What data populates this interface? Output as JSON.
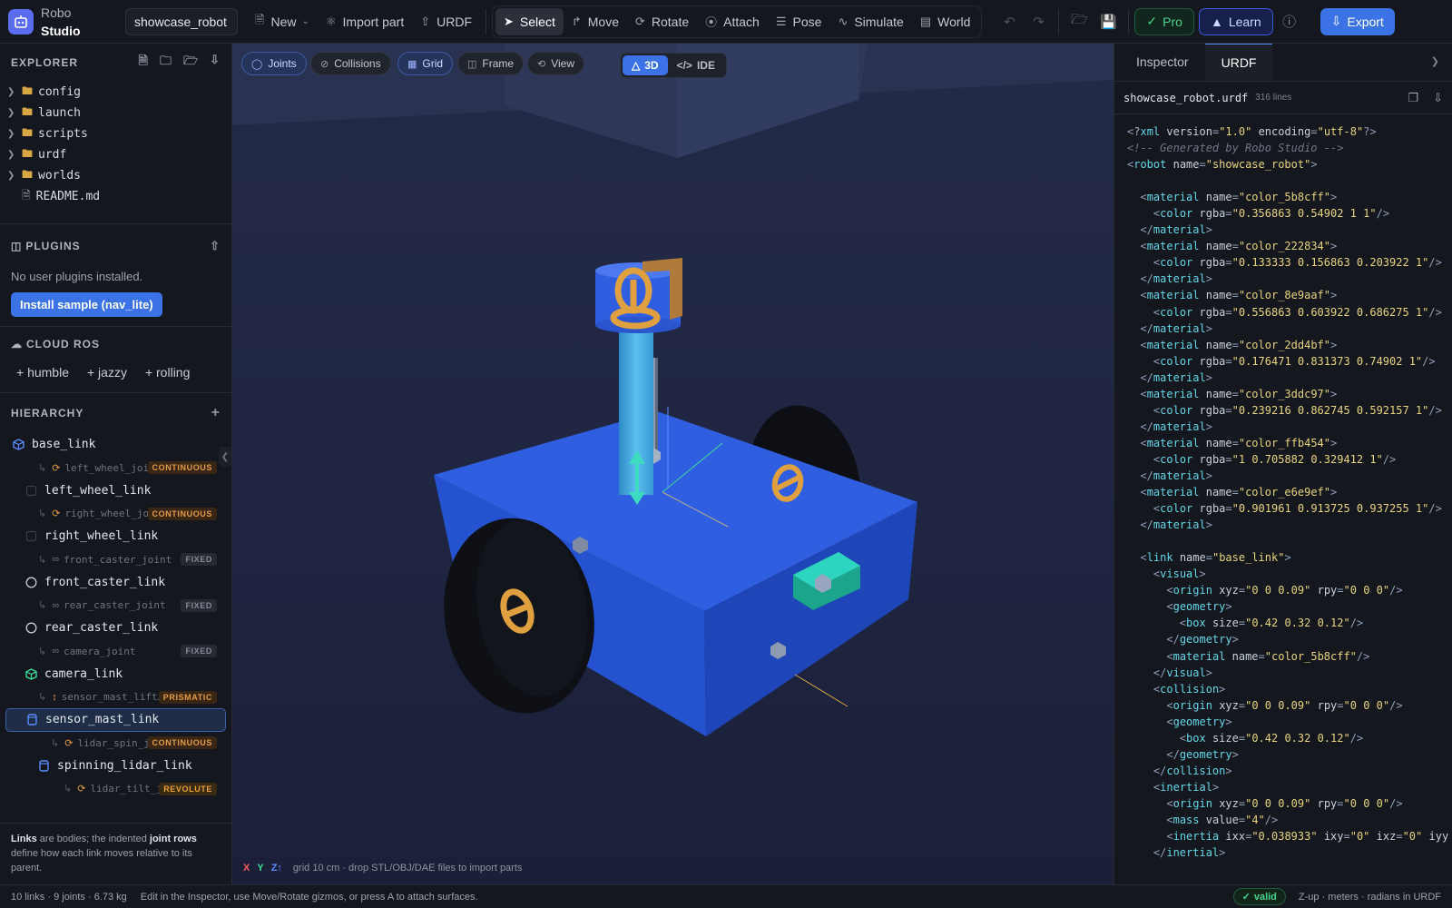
{
  "app": {
    "name_line1": "Robo",
    "name_line2": "Studio",
    "project_name": "showcase_robot"
  },
  "toolbar": {
    "new": "New",
    "import_part": "Import part",
    "urdf": "URDF",
    "modes": [
      "Select",
      "Move",
      "Rotate",
      "Attach",
      "Pose",
      "Simulate",
      "World"
    ],
    "active_mode": "Select",
    "pro": "Pro",
    "learn": "Learn",
    "export": "Export"
  },
  "explorer": {
    "title": "EXPLORER",
    "folders": [
      "config",
      "launch",
      "scripts",
      "urdf",
      "worlds"
    ],
    "files": [
      "README.md"
    ]
  },
  "plugins": {
    "title": "PLUGINS",
    "empty": "No user plugins installed.",
    "install": "Install sample (nav_lite)"
  },
  "cloud_ros": {
    "title": "CLOUD ROS",
    "distros": [
      "+ humble",
      "+ jazzy",
      "+ rolling"
    ]
  },
  "hierarchy": {
    "title": "HIERARCHY",
    "rows": [
      {
        "kind": "link",
        "name": "base_link",
        "indent": 0,
        "icon": "cube"
      },
      {
        "kind": "joint",
        "name": "left_wheel_joi…",
        "type": "CONTINUOUS",
        "indent": 1
      },
      {
        "kind": "link",
        "name": "left_wheel_link",
        "indent": 1,
        "icon": "cylinder"
      },
      {
        "kind": "joint",
        "name": "right_wheel_jo…",
        "type": "CONTINUOUS",
        "indent": 1
      },
      {
        "kind": "link",
        "name": "right_wheel_link",
        "indent": 1,
        "icon": "cylinder"
      },
      {
        "kind": "joint",
        "name": "front_caster_joint",
        "type": "FIXED",
        "indent": 1
      },
      {
        "kind": "link",
        "name": "front_caster_link",
        "indent": 1,
        "icon": "sphere"
      },
      {
        "kind": "joint",
        "name": "rear_caster_joint",
        "type": "FIXED",
        "indent": 1
      },
      {
        "kind": "link",
        "name": "rear_caster_link",
        "indent": 1,
        "icon": "sphere"
      },
      {
        "kind": "joint",
        "name": "camera_joint",
        "type": "FIXED",
        "indent": 1
      },
      {
        "kind": "link",
        "name": "camera_link",
        "indent": 1,
        "icon": "mesh"
      },
      {
        "kind": "joint",
        "name": "sensor_mast_lift…",
        "type": "PRISMATIC",
        "indent": 1
      },
      {
        "kind": "link",
        "name": "sensor_mast_link",
        "indent": 1,
        "icon": "mast",
        "selected": true
      },
      {
        "kind": "joint",
        "name": "lidar_spin_j…",
        "type": "CONTINUOUS",
        "indent": 2
      },
      {
        "kind": "link",
        "name": "spinning_lidar_link",
        "indent": 2,
        "icon": "mast"
      },
      {
        "kind": "joint",
        "name": "lidar_tilt_j…",
        "type": "REVOLUTE",
        "indent": 3
      }
    ],
    "footnote_parts": [
      "Links",
      " are bodies; the indented ",
      "joint rows",
      " define how each link moves relative to its parent."
    ]
  },
  "viewport": {
    "toggles": [
      "Joints",
      "Collisions",
      "Grid",
      "Frame",
      "View"
    ],
    "active_toggles": [
      "Joints",
      "Grid"
    ],
    "view_modes": [
      "3D",
      "IDE"
    ],
    "active_view": "3D",
    "axes": [
      "X",
      "Y",
      "Z↑"
    ],
    "hint": "grid 10 cm · drop STL/OBJ/DAE files to import parts"
  },
  "inspector": {
    "tabs": [
      "Inspector",
      "URDF"
    ],
    "active_tab": "URDF",
    "file_name": "showcase_robot.urdf",
    "line_count": "316 lines",
    "code_lines": [
      "<?xml version=\"1.0\" encoding=\"utf-8\"?>",
      "<!-- Generated by Robo Studio -->",
      "<robot name=\"showcase_robot\">",
      "",
      "  <material name=\"color_5b8cff\">",
      "    <color rgba=\"0.356863 0.54902 1 1\"/>",
      "  </material>",
      "  <material name=\"color_222834\">",
      "    <color rgba=\"0.133333 0.156863 0.203922 1\"/>",
      "  </material>",
      "  <material name=\"color_8e9aaf\">",
      "    <color rgba=\"0.556863 0.603922 0.686275 1\"/>",
      "  </material>",
      "  <material name=\"color_2dd4bf\">",
      "    <color rgba=\"0.176471 0.831373 0.74902 1\"/>",
      "  </material>",
      "  <material name=\"color_3ddc97\">",
      "    <color rgba=\"0.239216 0.862745 0.592157 1\"/>",
      "  </material>",
      "  <material name=\"color_ffb454\">",
      "    <color rgba=\"1 0.705882 0.329412 1\"/>",
      "  </material>",
      "  <material name=\"color_e6e9ef\">",
      "    <color rgba=\"0.901961 0.913725 0.937255 1\"/>",
      "  </material>",
      "",
      "  <link name=\"base_link\">",
      "    <visual>",
      "      <origin xyz=\"0 0 0.09\" rpy=\"0 0 0\"/>",
      "      <geometry>",
      "        <box size=\"0.42 0.32 0.12\"/>",
      "      </geometry>",
      "      <material name=\"color_5b8cff\"/>",
      "    </visual>",
      "    <collision>",
      "      <origin xyz=\"0 0 0.09\" rpy=\"0 0 0\"/>",
      "      <geometry>",
      "        <box size=\"0.42 0.32 0.12\"/>",
      "      </geometry>",
      "    </collision>",
      "    <inertial>",
      "      <origin xyz=\"0 0 0.09\" rpy=\"0 0 0\"/>",
      "      <mass value=\"4\"/>",
      "      <inertia ixx=\"0.038933\" ixy=\"0\" ixz=\"0\" iyy",
      "    </inertial>"
    ]
  },
  "status": {
    "stats": "10 links · 9 joints · 6.73 kg",
    "hint": "Edit in the Inspector, use Move/Rotate gizmos, or press A to attach surfaces.",
    "valid": "valid",
    "units": "Z-up · meters · radians in URDF"
  },
  "colors": {
    "accent": "#3b72e6",
    "pro": "#4ad38a",
    "body_blue": "#2f57d8",
    "wheel": "#0d0f14",
    "mast": "#4aa8e0",
    "joint_ring": "#e0a040"
  }
}
